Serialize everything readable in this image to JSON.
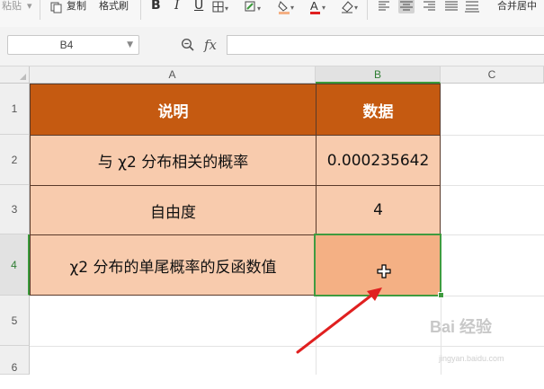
{
  "ribbon": {
    "paste_label": "粘贴",
    "copy_label": "复制",
    "format_painter_label": "格式刷",
    "bold": "B",
    "italic": "I",
    "underline": "U",
    "font_color_letter": "A",
    "merge_center_label": "合并居中",
    "active_align": "center"
  },
  "formula_bar": {
    "name_box": "B4",
    "fx_label": "fx",
    "formula": ""
  },
  "grid": {
    "columns": [
      "A",
      "B",
      "C"
    ],
    "rows": [
      "1",
      "2",
      "3",
      "4",
      "5",
      "6"
    ],
    "selected_column": "B",
    "selected_row": "4"
  },
  "table": {
    "header": {
      "col_a": "说明",
      "col_b": "数据"
    },
    "rows": [
      {
        "desc": "与 χ2 分布相关的概率",
        "value": "0.000235642"
      },
      {
        "desc": "自由度",
        "value": "4"
      },
      {
        "desc": "χ2 分布的单尾概率的反函数值",
        "value": ""
      }
    ]
  },
  "colors": {
    "header_fill": "#c55a11",
    "body_fill": "#f8cbad",
    "active_fill": "#f4b084",
    "selection_border": "#3f9b3f",
    "arrow": "#e02020"
  },
  "watermark": {
    "text": "Bai 经验",
    "sub": "jingyan.baidu.com"
  }
}
